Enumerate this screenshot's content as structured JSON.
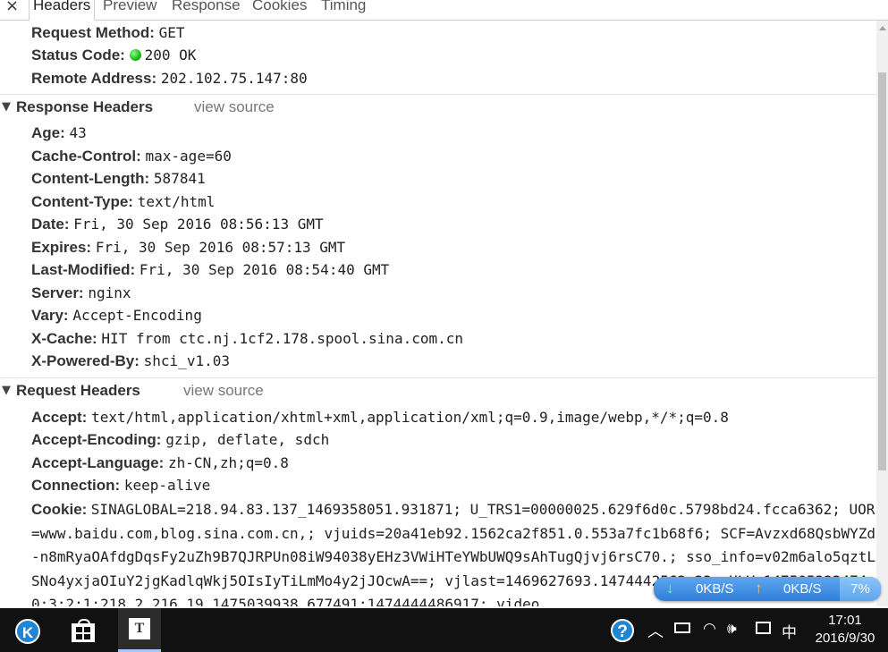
{
  "tabs": {
    "close": "×",
    "items": [
      "Headers",
      "Preview",
      "Response",
      "Cookies",
      "Timing"
    ]
  },
  "general": {
    "request_method": {
      "key": "Request Method:",
      "value": "GET"
    },
    "status_code": {
      "key": "Status Code:",
      "value": "200 OK"
    },
    "remote_address": {
      "key": "Remote Address:",
      "value": "202.102.75.147:80"
    }
  },
  "response_headers": {
    "title": "Response Headers",
    "view_source": "view source",
    "items": [
      {
        "key": "Age:",
        "value": "43"
      },
      {
        "key": "Cache-Control:",
        "value": "max-age=60"
      },
      {
        "key": "Content-Length:",
        "value": "587841"
      },
      {
        "key": "Content-Type:",
        "value": "text/html"
      },
      {
        "key": "Date:",
        "value": "Fri, 30 Sep 2016 08:56:13 GMT"
      },
      {
        "key": "Expires:",
        "value": "Fri, 30 Sep 2016 08:57:13 GMT"
      },
      {
        "key": "Last-Modified:",
        "value": "Fri, 30 Sep 2016 08:54:40 GMT"
      },
      {
        "key": "Server:",
        "value": "nginx"
      },
      {
        "key": "Vary:",
        "value": "Accept-Encoding"
      },
      {
        "key": "X-Cache:",
        "value": "HIT from ctc.nj.1cf2.178.spool.sina.com.cn"
      },
      {
        "key": "X-Powered-By:",
        "value": "shci_v1.03"
      }
    ]
  },
  "request_headers": {
    "title": "Request Headers",
    "view_source": "view source",
    "items": [
      {
        "key": "Accept:",
        "value": "text/html,application/xhtml+xml,application/xml;q=0.9,image/webp,*/*;q=0.8"
      },
      {
        "key": "Accept-Encoding:",
        "value": "gzip, deflate, sdch"
      },
      {
        "key": "Accept-Language:",
        "value": "zh-CN,zh;q=0.8"
      },
      {
        "key": "Connection:",
        "value": "keep-alive"
      }
    ],
    "cookie": {
      "key": "Cookie:",
      "value": "SINAGLOBAL=218.94.83.137_1469358051.931871; U_TRS1=00000025.629f6d0c.5798bd24.fcca6362; UOR=www.baidu.com,blog.sina.com.cn,; vjuids=20a41eb92.1562ca2f851.0.553a7fc1b68f6; SCF=Avzxd68QsbWYZd-n8mRyaOAfdgDqsFy2uZh9B7QJRPUn08iW94038yEHz3VWiHTeYWbUWQ9sAhTugQjvj6rsC70.; sso_info=v02m6alo5qztLSNo4yxjaOIuY2jgKadlqWkj5OIsIyTiLmMo4y2jJOcwA==; vjlast=1469627693.1474442562.23; ULV=1475053234740:3:2:1:218.2.216.19_1475039938.677491:1474444486917; video_"
    }
  },
  "netmeter": {
    "download": "0KB/S",
    "upload": "0KB/S",
    "percent": "7%",
    "download_color": "#7dff7d",
    "upload_color": "#ffc24a"
  },
  "taskbar": {
    "start_letter": "K",
    "app_letter": "T",
    "help": "?",
    "ime": "中",
    "time": "17:01",
    "date": "2016/9/30"
  }
}
